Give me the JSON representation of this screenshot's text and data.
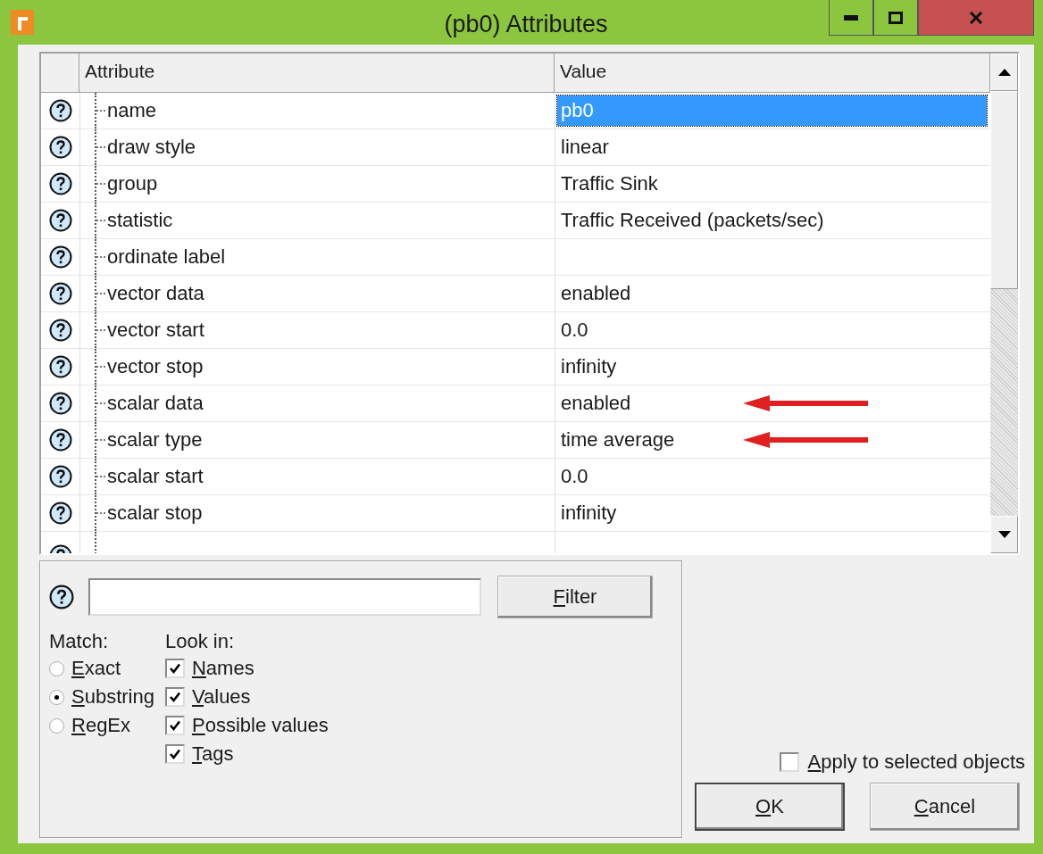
{
  "window": {
    "title": "(pb0) Attributes"
  },
  "table": {
    "columns": [
      "Attribute",
      "Value"
    ],
    "rows": [
      {
        "attribute": "name",
        "value": "pb0",
        "selected": true,
        "marked": false
      },
      {
        "attribute": "draw style",
        "value": "linear",
        "selected": false,
        "marked": false
      },
      {
        "attribute": "group",
        "value": "Traffic Sink",
        "selected": false,
        "marked": false
      },
      {
        "attribute": "statistic",
        "value": "Traffic Received (packets/sec)",
        "selected": false,
        "marked": false
      },
      {
        "attribute": "ordinate label",
        "selected": false,
        "marked": false
      },
      {
        "attribute": "vector data",
        "value": "enabled",
        "selected": false,
        "marked": false
      },
      {
        "attribute": "vector start",
        "value": "0.0",
        "selected": false,
        "marked": false
      },
      {
        "attribute": "vector stop",
        "value": "infinity",
        "selected": false,
        "marked": false
      },
      {
        "attribute": "scalar data",
        "value": "enabled",
        "selected": false,
        "marked": true
      },
      {
        "attribute": "scalar type",
        "value": "time average",
        "selected": false,
        "marked": true
      },
      {
        "attribute": "scalar start",
        "value": "0.0",
        "selected": false,
        "marked": false
      },
      {
        "attribute": "scalar stop",
        "value": "infinity",
        "selected": false,
        "marked": false
      }
    ]
  },
  "filter": {
    "button": {
      "label": "Filter",
      "underlined_initial": true
    },
    "match": {
      "label": "Match:",
      "options": [
        {
          "label": "Exact",
          "underlined_initial": true,
          "selected": false
        },
        {
          "label": "Substring",
          "underlined_initial": true,
          "selected": true
        },
        {
          "label": "RegEx",
          "underlined_initial": true,
          "selected": false
        }
      ]
    },
    "look_in": {
      "label": "Look in:",
      "options": [
        {
          "label": "Names",
          "underlined_initial": true,
          "checked": true
        },
        {
          "label": "Values",
          "underlined_initial": true,
          "checked": true
        },
        {
          "label": "Possible values",
          "underlined_initial": true,
          "checked": true
        },
        {
          "label": "Tags",
          "underlined_initial": true,
          "checked": true
        }
      ]
    }
  },
  "apply": {
    "label": "Apply to selected objects",
    "underlined_initial": true,
    "checked": false
  },
  "buttons": [
    {
      "label": "OK",
      "underlined_initial": true,
      "kind": "default"
    },
    {
      "label": "Cancel",
      "underlined_initial": true,
      "kind": "normal"
    }
  ]
}
